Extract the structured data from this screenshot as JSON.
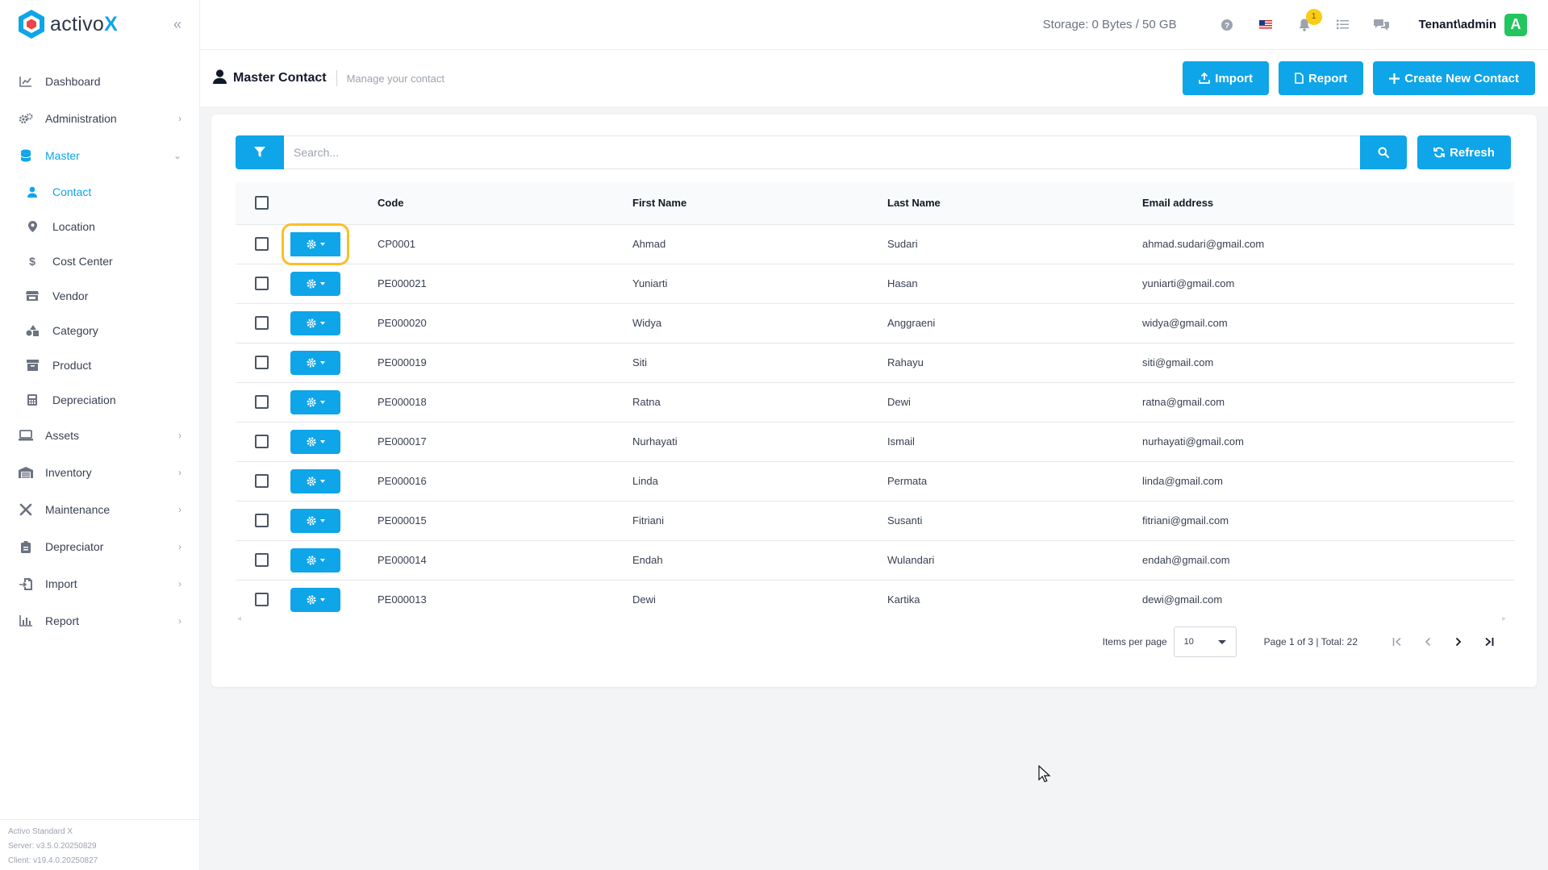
{
  "app": {
    "logo_text_main": "activo",
    "logo_text_accent": "X"
  },
  "sidebar": {
    "items": [
      {
        "label": "Dashboard",
        "icon": "chart-line-icon"
      },
      {
        "label": "Administration",
        "icon": "gears-icon"
      },
      {
        "label": "Master",
        "icon": "database-icon"
      },
      {
        "label": "Assets",
        "icon": "laptop-icon"
      },
      {
        "label": "Inventory",
        "icon": "warehouse-icon"
      },
      {
        "label": "Maintenance",
        "icon": "tools-icon"
      },
      {
        "label": "Depreciator",
        "icon": "clipboard-icon"
      },
      {
        "label": "Import",
        "icon": "file-import-icon"
      },
      {
        "label": "Report",
        "icon": "chart-bar-icon"
      }
    ],
    "master_sub": [
      {
        "label": "Contact",
        "icon": "user-icon"
      },
      {
        "label": "Location",
        "icon": "map-pin-icon"
      },
      {
        "label": "Cost Center",
        "icon": "dollar-icon"
      },
      {
        "label": "Vendor",
        "icon": "store-icon"
      },
      {
        "label": "Category",
        "icon": "shapes-icon"
      },
      {
        "label": "Product",
        "icon": "archive-icon"
      },
      {
        "label": "Depreciation",
        "icon": "calculator-icon"
      }
    ],
    "version": {
      "product": "Activo Standard X",
      "server": "Server: v3.5.0.20250829",
      "client": "Client: v19.4.0.20250827"
    }
  },
  "topbar": {
    "storage": "Storage: 0 Bytes / 50 GB",
    "notification_count": "1",
    "user": "Tenant\\admin",
    "avatar_letter": "A"
  },
  "page": {
    "title": "Master Contact",
    "subtitle": "Manage your contact",
    "import_label": "Import",
    "report_label": "Report",
    "create_label": "Create New Contact"
  },
  "search": {
    "placeholder": "Search...",
    "refresh_label": "Refresh"
  },
  "table": {
    "headers": {
      "code": "Code",
      "first": "First Name",
      "last": "Last Name",
      "email": "Email address"
    },
    "rows": [
      {
        "code": "CP0001",
        "first": "Ahmad",
        "last": "Sudari",
        "email": "ahmad.sudari@gmail.com"
      },
      {
        "code": "PE000021",
        "first": "Yuniarti",
        "last": "Hasan",
        "email": "yuniarti@gmail.com"
      },
      {
        "code": "PE000020",
        "first": "Widya",
        "last": "Anggraeni",
        "email": "widya@gmail.com"
      },
      {
        "code": "PE000019",
        "first": "Siti",
        "last": "Rahayu",
        "email": "siti@gmail.com"
      },
      {
        "code": "PE000018",
        "first": "Ratna",
        "last": "Dewi",
        "email": "ratna@gmail.com"
      },
      {
        "code": "PE000017",
        "first": "Nurhayati",
        "last": "Ismail",
        "email": "nurhayati@gmail.com"
      },
      {
        "code": "PE000016",
        "first": "Linda",
        "last": "Permata",
        "email": "linda@gmail.com"
      },
      {
        "code": "PE000015",
        "first": "Fitriani",
        "last": "Susanti",
        "email": "fitriani@gmail.com"
      },
      {
        "code": "PE000014",
        "first": "Endah",
        "last": "Wulandari",
        "email": "endah@gmail.com"
      },
      {
        "code": "PE000013",
        "first": "Dewi",
        "last": "Kartika",
        "email": "dewi@gmail.com"
      }
    ]
  },
  "pager": {
    "items_per_page_label": "Items per page",
    "items_per_page_value": "10",
    "page_info": "Page 1 of 3 | Total: 22"
  },
  "colors": {
    "accent": "#0ea5e9",
    "highlight": "#fbbf24",
    "avatar": "#22c55e"
  }
}
